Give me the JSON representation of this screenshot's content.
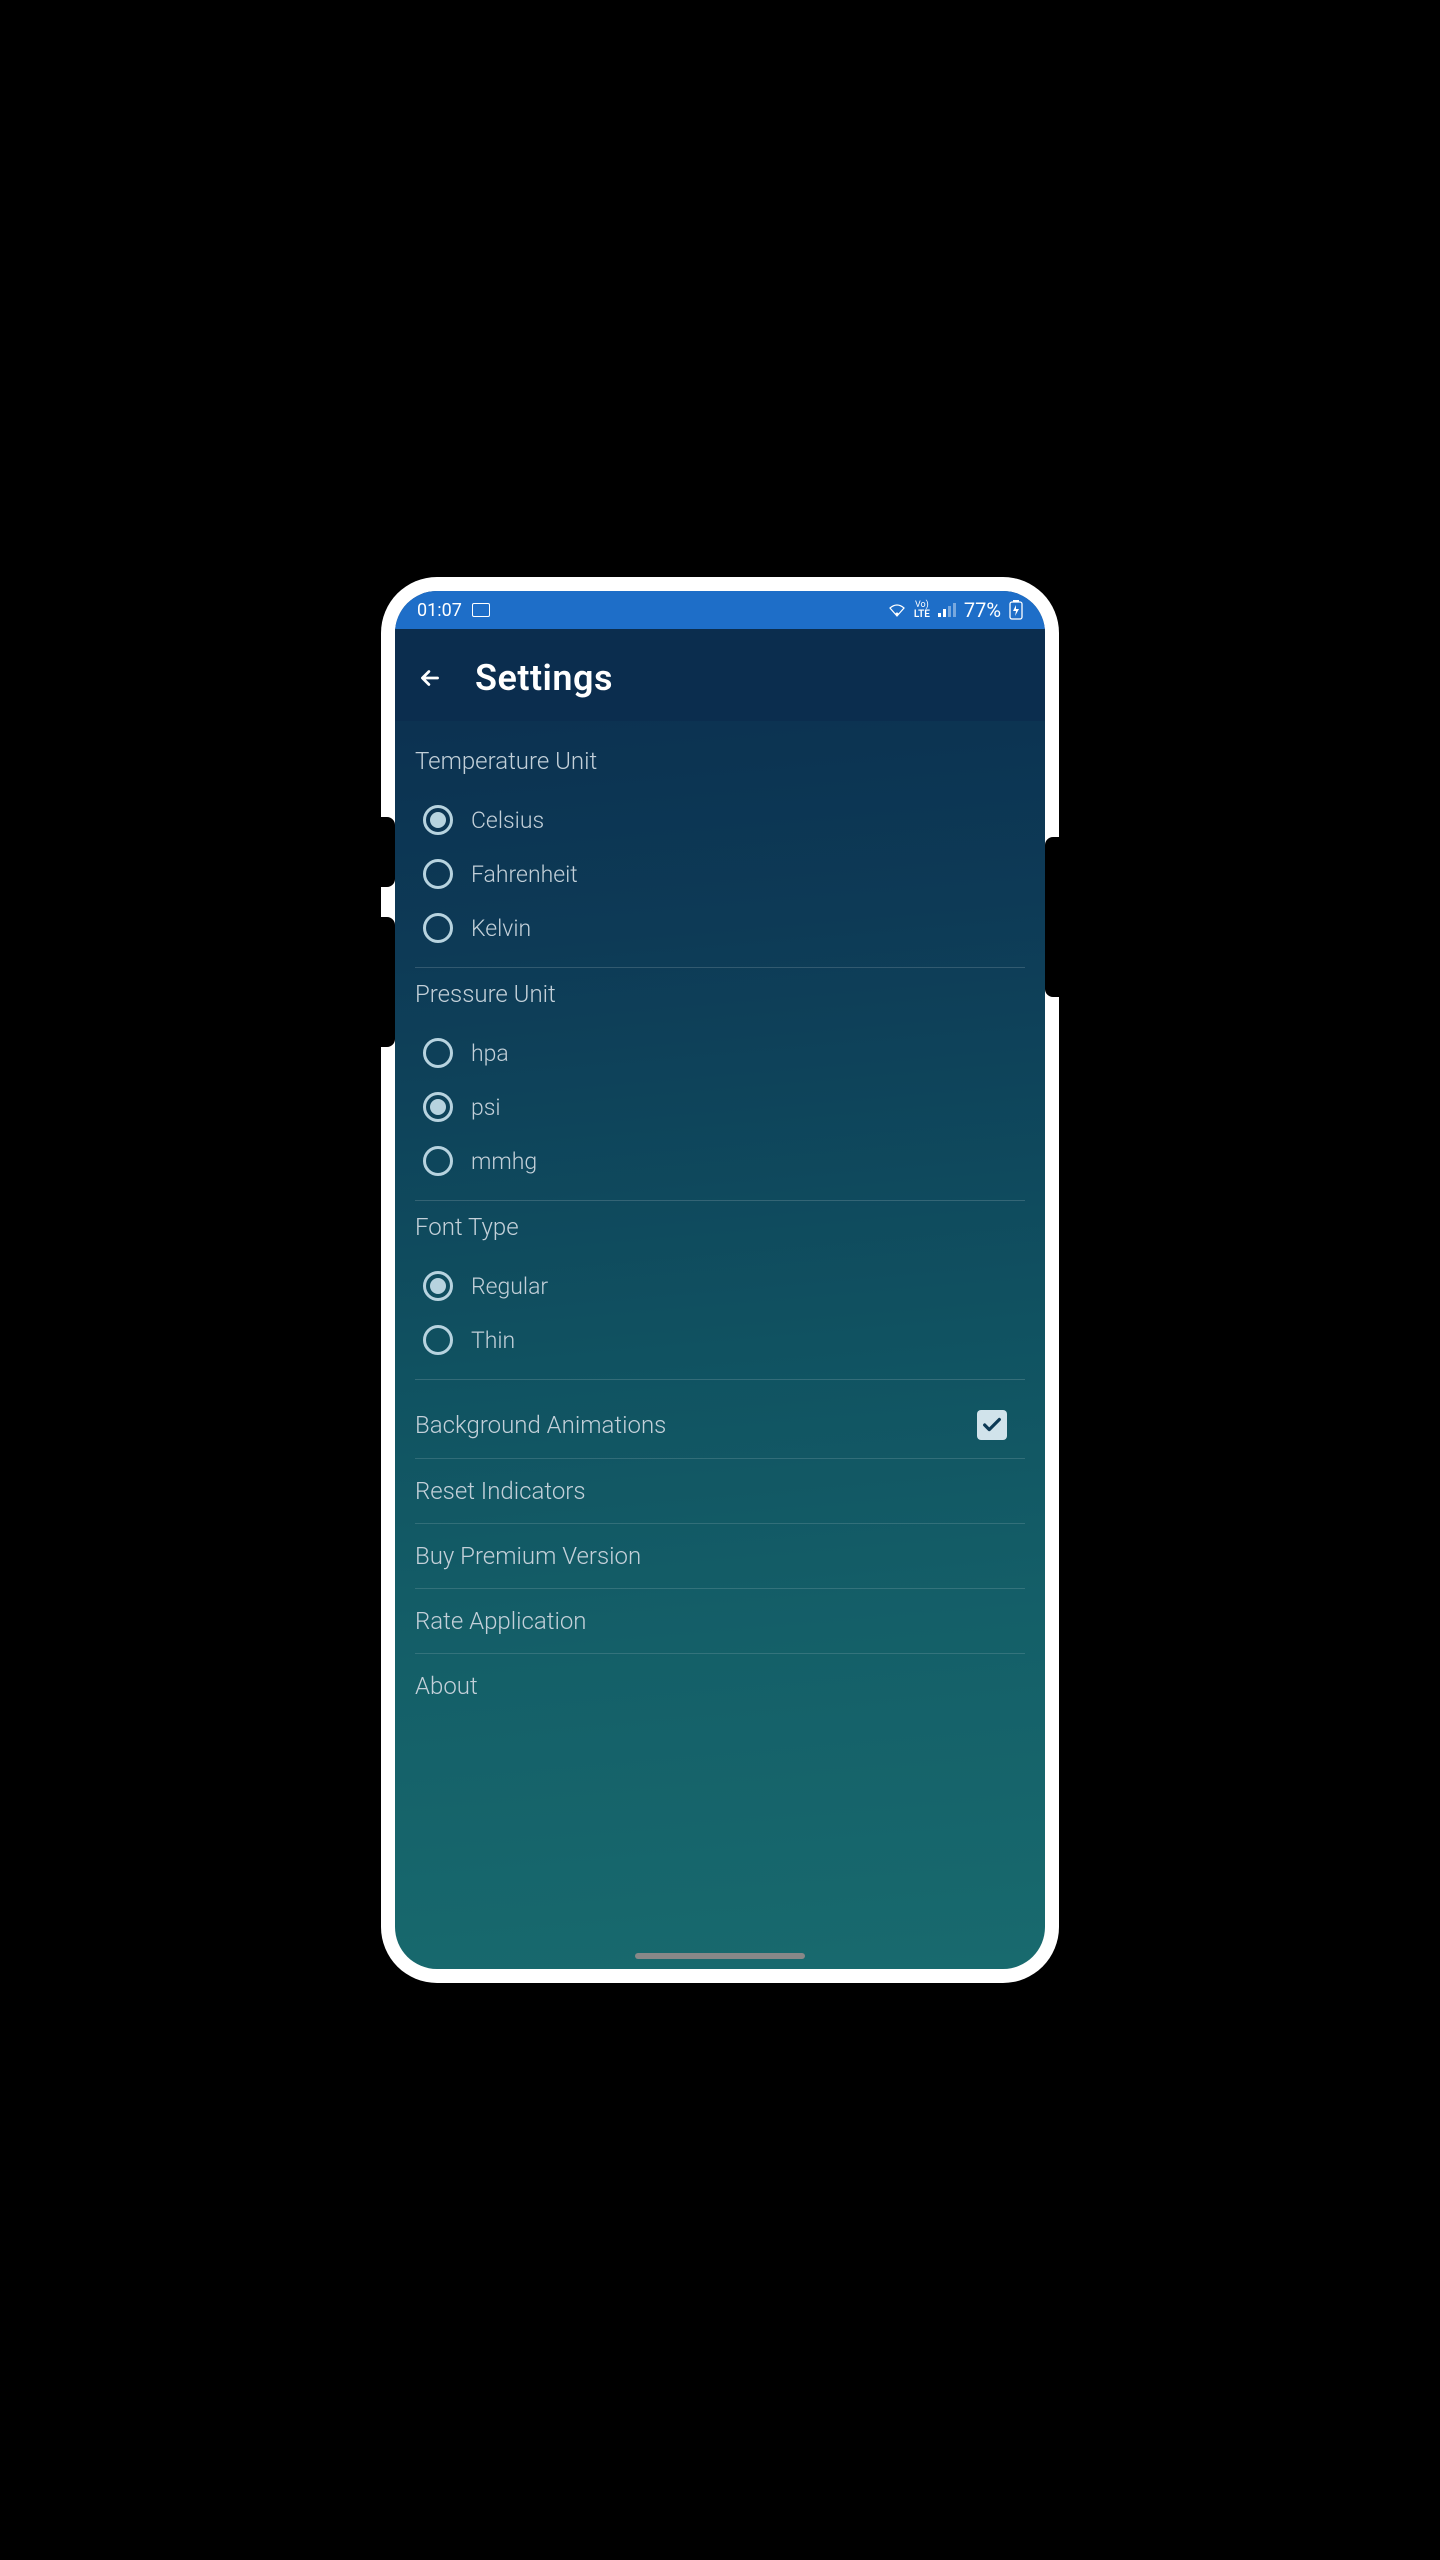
{
  "status": {
    "time": "01:07",
    "battery": "77%",
    "lte_top": "Vo)",
    "lte_bottom": "LTE"
  },
  "header": {
    "title": "Settings"
  },
  "sections": {
    "temp": {
      "title": "Temperature Unit",
      "options": {
        "celsius": "Celsius",
        "fahrenheit": "Fahrenheit",
        "kelvin": "Kelvin"
      }
    },
    "pressure": {
      "title": "Pressure Unit",
      "options": {
        "hpa": "hpa",
        "psi": "psi",
        "mmhg": "mmhg"
      }
    },
    "font": {
      "title": "Font Type",
      "options": {
        "regular": "Regular",
        "thin": "Thin"
      }
    }
  },
  "actions": {
    "bg_anim": "Background Animations",
    "reset": "Reset Indicators",
    "premium": "Buy Premium Version",
    "rate": "Rate Application",
    "about": "About"
  },
  "state": {
    "temp_selected": "celsius",
    "pressure_selected": "psi",
    "font_selected": "regular",
    "bg_anim_checked": true
  }
}
